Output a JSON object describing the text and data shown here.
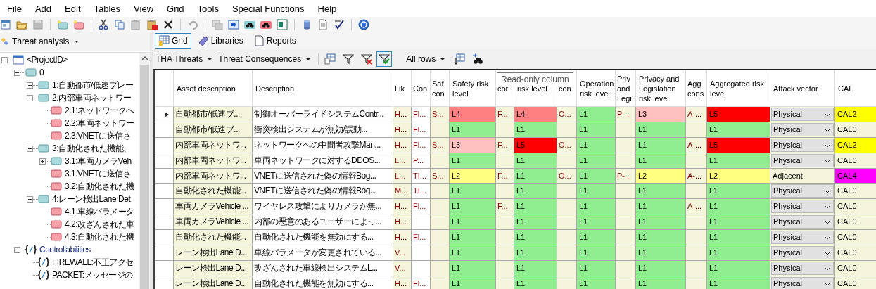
{
  "menu": [
    "File",
    "Add",
    "Edit",
    "Tables",
    "View",
    "Grid",
    "Tools",
    "Special Functions",
    "Help"
  ],
  "sidebar": {
    "view": "Threat analysis",
    "tree": [
      {
        "label": "<ProjectID>",
        "kind": "project",
        "expanded": true,
        "children": [
          {
            "label": "0",
            "kind": "group",
            "expanded": true,
            "children": [
              {
                "label": "1:自動都市/低速ブレー",
                "kind": "group",
                "expanded": false
              },
              {
                "label": "2:内部車両ネットワー",
                "kind": "group",
                "expanded": true,
                "children": [
                  {
                    "label": "2.1:ネットワークへ",
                    "kind": "threat"
                  },
                  {
                    "label": "2.2:車両ネットワー",
                    "kind": "threat"
                  },
                  {
                    "label": "2.3:VNETに送信さ",
                    "kind": "threat"
                  }
                ]
              },
              {
                "label": "3:自動化された機能、",
                "kind": "group",
                "expanded": true,
                "children": [
                  {
                    "label": "3.1:車両カメラVeh",
                    "kind": "group",
                    "expanded": false
                  },
                  {
                    "label": "3.1:VNETに送信さ",
                    "kind": "threat"
                  },
                  {
                    "label": "3.2:自動化された機",
                    "kind": "threat"
                  }
                ]
              },
              {
                "label": "4:レーン検出Lane Det",
                "kind": "group",
                "expanded": true,
                "children": [
                  {
                    "label": "4.1:車線パラメータ",
                    "kind": "threat"
                  },
                  {
                    "label": "4.2:改ざんされた車",
                    "kind": "threat"
                  },
                  {
                    "label": "4.3:自動化された機",
                    "kind": "threat"
                  }
                ]
              }
            ]
          },
          {
            "label": "Controllabilities",
            "kind": "category",
            "expanded": true,
            "children": [
              {
                "label": "FIREWALL:不正アクセ",
                "kind": "control"
              },
              {
                "label": "PACKET:メッセージの",
                "kind": "control"
              }
            ]
          }
        ]
      }
    ]
  },
  "tabs": [
    {
      "label": "Grid",
      "selected": true
    },
    {
      "label": "Libraries",
      "selected": false
    },
    {
      "label": "Reports",
      "selected": false
    }
  ],
  "grid_toolbar": {
    "views": [
      "THA Threats",
      "Threat Consequences"
    ],
    "filter_active": true,
    "rows": "All rows"
  },
  "tooltip": "Read-only column",
  "columns": [
    {
      "header": "Asset description",
      "kind": "text",
      "read_only": true
    },
    {
      "header": "Description",
      "kind": "text",
      "read_only": false
    },
    {
      "header": "Lik",
      "kind": "code",
      "read_only": true
    },
    {
      "header": "Con",
      "kind": "code",
      "read_only": false
    },
    {
      "header": "Saf con",
      "kind": "code",
      "read_only": true
    },
    {
      "header": "Safety risk level",
      "kind": "rating"
    },
    {
      "header": "cor",
      "kind": "code",
      "read_only": true
    },
    {
      "header": "risk level",
      "kind": "rating"
    },
    {
      "header": "con",
      "kind": "code",
      "read_only": true
    },
    {
      "header": "Operation risk level",
      "kind": "rating"
    },
    {
      "header": "Priv and Legi",
      "kind": "code",
      "read_only": true
    },
    {
      "header": "Privacy and Legislation risk level",
      "kind": "rating"
    },
    {
      "header": "Agg cons",
      "kind": "code",
      "read_only": true
    },
    {
      "header": "Aggregated risk level",
      "kind": "rating"
    },
    {
      "header": "Attack vector",
      "kind": "vector"
    },
    {
      "header": "CAL",
      "kind": "rating",
      "read_only": true
    }
  ],
  "rows": [
    {
      "selected": true,
      "cells": [
        "自動都市/低速ブ...",
        "制御オーバーライドシステムContr...",
        "H...",
        "Fl...",
        "S...",
        {
          "text": "L4",
          "color": "#ff8080"
        },
        "F...",
        {
          "text": "L4",
          "color": "#ff8080"
        },
        "O...",
        {
          "text": "L1",
          "color": "#90ee90"
        },
        "P-...",
        {
          "text": "L3",
          "color": "#ffc0c0"
        },
        "A-...",
        {
          "text": "L5",
          "color": "#ff0000"
        },
        {
          "text": "Physical",
          "kind": "dropdown"
        },
        {
          "text": "CAL2",
          "color": "#ffff00"
        }
      ]
    },
    {
      "selected": false,
      "cells": [
        "自動都市/低速ブ...",
        "衝突検出システムが無効/誤動...",
        "H...",
        "Fl...",
        null,
        {
          "text": "L1",
          "color": "#90ee90"
        },
        null,
        {
          "text": "L1",
          "color": "#90ee90"
        },
        null,
        {
          "text": "L1",
          "color": "#90ee90"
        },
        null,
        {
          "text": "L1",
          "color": "#90ee90"
        },
        null,
        {
          "text": "L1",
          "color": "#90ee90"
        },
        {
          "text": "Physical",
          "kind": "dropdown"
        },
        {
          "text": "CAL0"
        }
      ]
    },
    {
      "selected": false,
      "cells": [
        "内部車両ネットワ...",
        "ネットワークへの中間者攻撃Man...",
        "H...",
        "Fl...",
        "S...",
        {
          "text": "L3",
          "color": "#ffc0c0"
        },
        "F...",
        {
          "text": "L5",
          "color": "#ff0000"
        },
        "O...",
        {
          "text": "L1",
          "color": "#90ee90"
        },
        null,
        {
          "text": "L1",
          "color": "#90ee90"
        },
        "A-...",
        {
          "text": "L5",
          "color": "#ff0000"
        },
        {
          "text": "Physical",
          "kind": "dropdown"
        },
        {
          "text": "CAL2",
          "color": "#ffff00"
        }
      ]
    },
    {
      "selected": false,
      "cells": [
        "内部車両ネットワ...",
        "車両ネットワークに対するDDOS...",
        "L...",
        "P...",
        null,
        {
          "text": "L1",
          "color": "#90ee90"
        },
        null,
        {
          "text": "L1",
          "color": "#90ee90"
        },
        null,
        {
          "text": "L1",
          "color": "#90ee90"
        },
        null,
        {
          "text": "L1",
          "color": "#90ee90"
        },
        null,
        {
          "text": "L1",
          "color": "#90ee90"
        },
        {
          "text": "Physical",
          "kind": "dropdown"
        },
        {
          "text": "CAL0"
        }
      ]
    },
    {
      "selected": false,
      "cells": [
        "内部車両ネットワ...",
        "VNETに送信された偽の情報Bog...",
        "L...",
        "TI...",
        "S...",
        {
          "text": "L2",
          "color": "#ffff80"
        },
        "F...",
        {
          "text": "L1",
          "color": "#90ee90"
        },
        "O...",
        {
          "text": "L1",
          "color": "#90ee90"
        },
        "P-...",
        {
          "text": "L2",
          "color": "#ffff80"
        },
        "A-...",
        {
          "text": "L2",
          "color": "#ffff80"
        },
        {
          "text": "Adjacent",
          "kind": "plain"
        },
        {
          "text": "CAL4",
          "color": "#ff00ff"
        }
      ]
    },
    {
      "selected": false,
      "cells": [
        "自動化された機能...",
        "VNETに送信された偽の情報Bog...",
        "M...",
        "TI...",
        null,
        {
          "text": "L1",
          "color": "#90ee90"
        },
        null,
        {
          "text": "L1",
          "color": "#90ee90"
        },
        null,
        {
          "text": "L1",
          "color": "#90ee90"
        },
        null,
        {
          "text": "L1",
          "color": "#90ee90"
        },
        null,
        {
          "text": "L1",
          "color": "#90ee90"
        },
        {
          "text": "Physical",
          "kind": "dropdown"
        },
        {
          "text": "CAL0"
        }
      ]
    },
    {
      "selected": false,
      "cells": [
        "車両カメラVehicle ...",
        "ワイヤレス攻撃によりカメラが無...",
        "H...",
        "Fl...",
        null,
        {
          "text": "L1",
          "color": "#90ee90"
        },
        "F...",
        {
          "text": "L1",
          "color": "#90ee90"
        },
        null,
        {
          "text": "L1",
          "color": "#90ee90"
        },
        null,
        {
          "text": "L1",
          "color": "#90ee90"
        },
        "A-...",
        {
          "text": "L1",
          "color": "#90ee90"
        },
        {
          "text": "Physical",
          "kind": "dropdown"
        },
        {
          "text": "CAL0"
        }
      ]
    },
    {
      "selected": false,
      "cells": [
        "車両カメラVehicle ...",
        "内部の悪意のあるユーザーによっ...",
        "H...",
        null,
        null,
        {
          "text": "L1",
          "color": "#90ee90"
        },
        null,
        {
          "text": "L1",
          "color": "#90ee90"
        },
        null,
        {
          "text": "L1",
          "color": "#90ee90"
        },
        null,
        {
          "text": "L1",
          "color": "#90ee90"
        },
        null,
        {
          "text": "L1",
          "color": "#90ee90"
        },
        {
          "text": "Physical",
          "kind": "dropdown"
        },
        {
          "text": "CAL0"
        }
      ]
    },
    {
      "selected": false,
      "cells": [
        "自動化された機能...",
        "自動化された機能を無効にする...",
        "H...",
        "Fl...",
        null,
        {
          "text": "L1",
          "color": "#90ee90"
        },
        null,
        {
          "text": "L1",
          "color": "#90ee90"
        },
        null,
        {
          "text": "L1",
          "color": "#90ee90"
        },
        null,
        {
          "text": "L1",
          "color": "#90ee90"
        },
        null,
        {
          "text": "L1",
          "color": "#90ee90"
        },
        {
          "text": "Physical",
          "kind": "dropdown"
        },
        {
          "text": "CAL0"
        }
      ]
    },
    {
      "selected": false,
      "cells": [
        "レーン検出Lane D...",
        "車線パラメータが変更されている...",
        "V...",
        null,
        null,
        {
          "text": "L1",
          "color": "#90ee90"
        },
        null,
        {
          "text": "L1",
          "color": "#90ee90"
        },
        null,
        {
          "text": "L1",
          "color": "#90ee90"
        },
        null,
        {
          "text": "L1",
          "color": "#90ee90"
        },
        null,
        {
          "text": "L1",
          "color": "#90ee90"
        },
        {
          "text": "Physical",
          "kind": "dropdown"
        },
        {
          "text": "CAL0"
        }
      ]
    },
    {
      "selected": false,
      "cells": [
        "レーン検出Lane D...",
        "改ざんされた車線検出システムL...",
        "V...",
        null,
        null,
        {
          "text": "L1",
          "color": "#90ee90"
        },
        null,
        {
          "text": "L1",
          "color": "#90ee90"
        },
        null,
        {
          "text": "L1",
          "color": "#90ee90"
        },
        null,
        {
          "text": "L1",
          "color": "#90ee90"
        },
        null,
        {
          "text": "L1",
          "color": "#90ee90"
        },
        {
          "text": "Physical",
          "kind": "dropdown"
        },
        {
          "text": "CAL0"
        }
      ]
    },
    {
      "selected": false,
      "cells": [
        "レーン検出Lane D...",
        "自動化された機能を無効にする...",
        "H...",
        "Fl...",
        null,
        {
          "text": "L1",
          "color": "#90ee90"
        },
        null,
        {
          "text": "L1",
          "color": "#90ee90"
        },
        null,
        {
          "text": "L1",
          "color": "#90ee90"
        },
        null,
        {
          "text": "L1",
          "color": "#90ee90"
        },
        null,
        {
          "text": "L1",
          "color": "#90ee90"
        },
        {
          "text": "Physical",
          "kind": "dropdown"
        },
        {
          "text": "CAL0"
        }
      ]
    }
  ]
}
